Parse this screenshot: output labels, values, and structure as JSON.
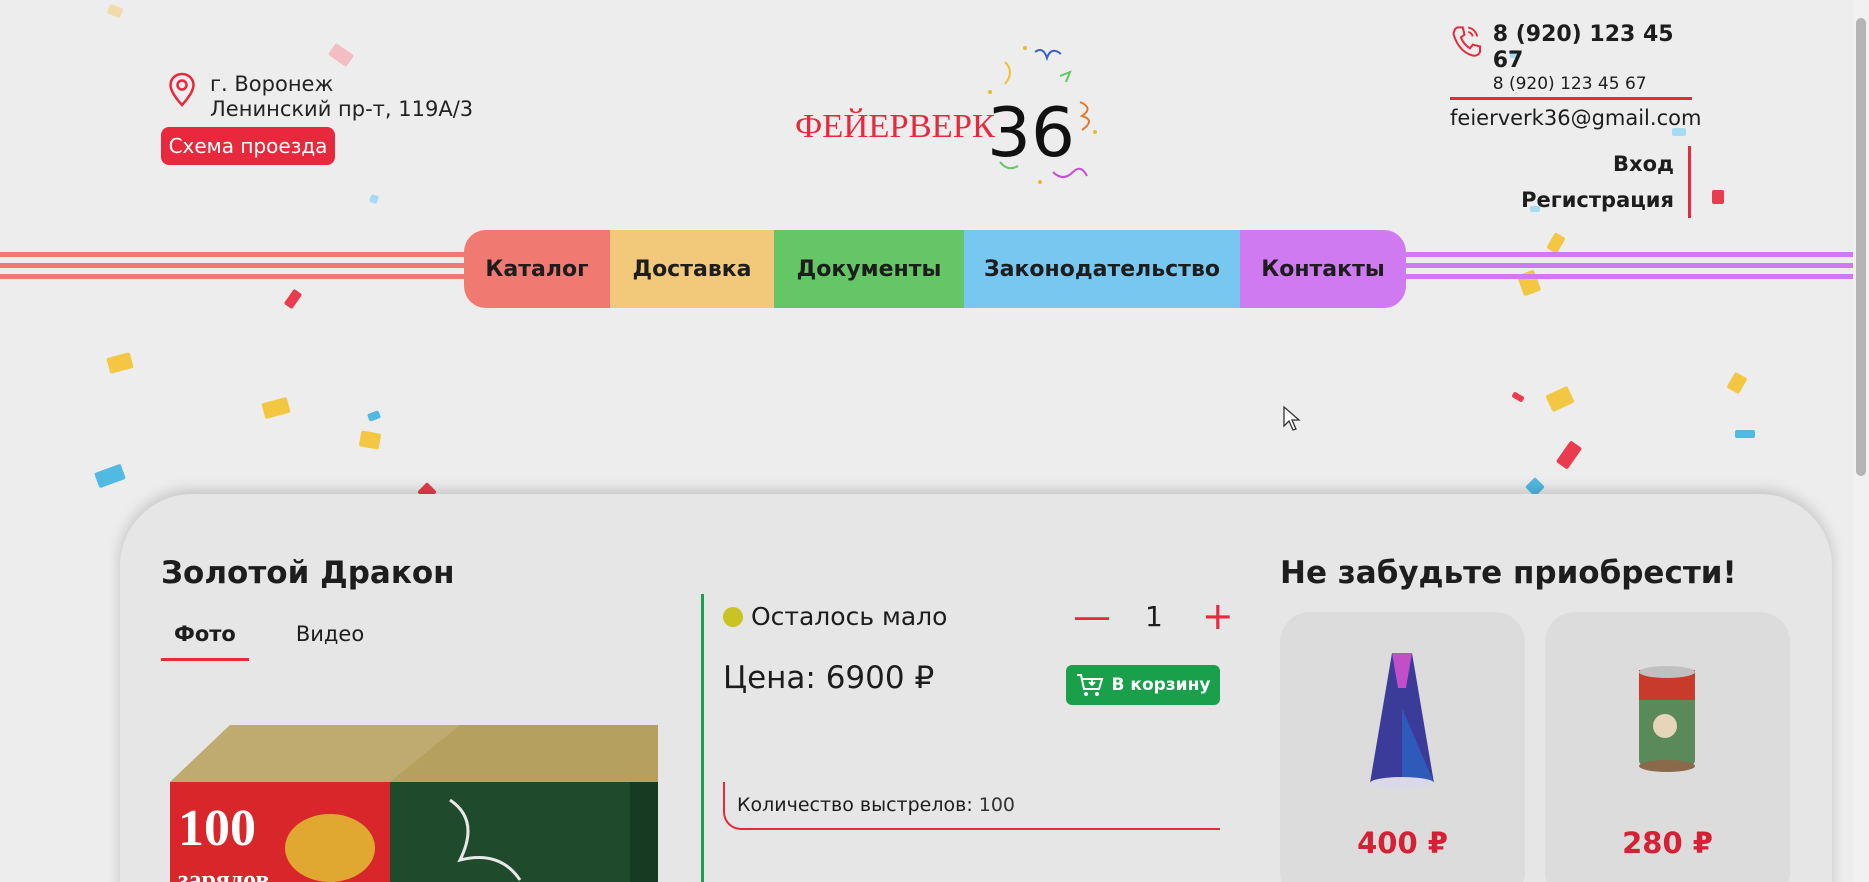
{
  "header": {
    "city": "г. Воронеж",
    "street": "Ленинский пр-т, 119А/3",
    "route_label": "Схема проезда",
    "phone_main": "8 (920) 123 45 67",
    "phone_sub": "8 (920) 123 45 67",
    "email": "feierverk36@gmail.com",
    "login": "Вход",
    "register": "Регистрация",
    "logo_text": "ФЕЙЕРВЕРК",
    "logo_number": "36"
  },
  "nav": {
    "items": [
      {
        "label": "Каталог",
        "color": "#f07a72"
      },
      {
        "label": "Доставка",
        "color": "#f2c97a"
      },
      {
        "label": "Документы",
        "color": "#64c665"
      },
      {
        "label": "Законодательство",
        "color": "#78c7f0"
      },
      {
        "label": "Контакты",
        "color": "#cf7af0"
      }
    ]
  },
  "product": {
    "title": "Золотой Дракон",
    "tabs": [
      "Фото",
      "Видео"
    ],
    "stock": "Осталось мало",
    "quantity": "1",
    "qty_minus": "—",
    "qty_plus": "+",
    "price": "Цена: 6900 ₽",
    "cart_label": "В корзину",
    "spec_label": "Количество выстрелов:",
    "spec_value": "100",
    "box_text_1": "100",
    "box_text_2": "зарядов"
  },
  "recommendations": {
    "title": "Не забудьте приобрести!",
    "items": [
      {
        "price": "400 ₽"
      },
      {
        "price": "280 ₽"
      }
    ]
  },
  "colors": {
    "accent": "#e8283c",
    "green": "#1aa04a"
  }
}
